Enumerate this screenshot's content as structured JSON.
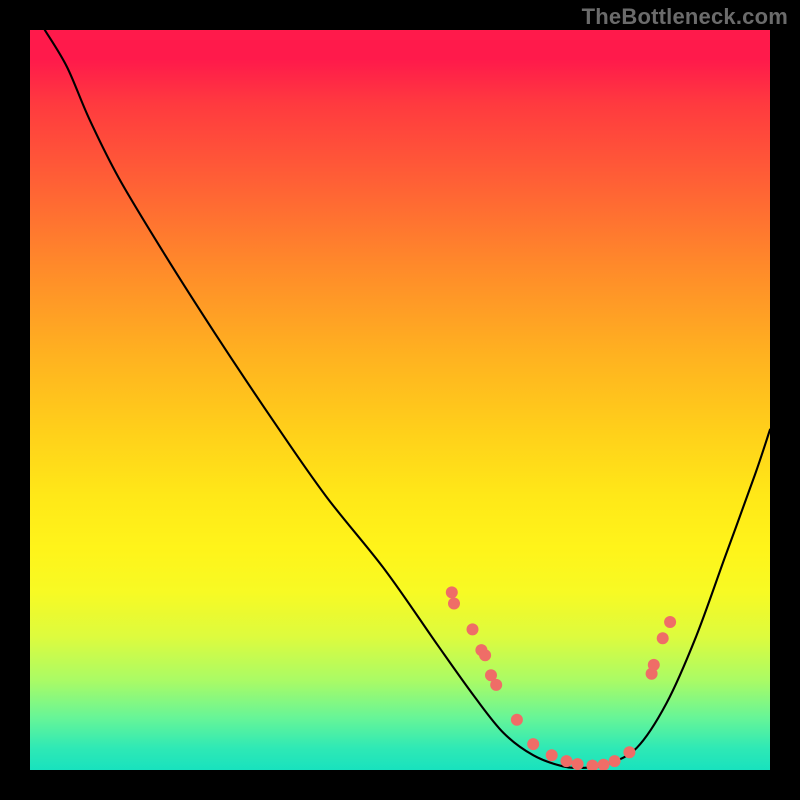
{
  "watermark": "TheBottleneck.com",
  "chart_data": {
    "type": "line",
    "title": "",
    "xlabel": "",
    "ylabel": "",
    "xlim": [
      0,
      100
    ],
    "ylim": [
      0,
      100
    ],
    "series": [
      {
        "name": "curve",
        "x": [
          2,
          5,
          8,
          12,
          18,
          25,
          33,
          40,
          48,
          55,
          60,
          64,
          68,
          72,
          75,
          78,
          82,
          86,
          90,
          94,
          98,
          100
        ],
        "values": [
          100,
          95,
          88,
          80,
          70,
          59,
          47,
          37,
          27,
          17,
          10,
          5,
          2,
          0.5,
          0.3,
          0.8,
          3,
          9,
          18,
          29,
          40,
          46
        ]
      }
    ],
    "scatter_points": {
      "name": "markers",
      "x": [
        57.0,
        57.3,
        59.8,
        61.0,
        61.5,
        62.3,
        63.0,
        65.8,
        68.0,
        70.5,
        72.5,
        74.0,
        76.0,
        77.5,
        79.0,
        81.0,
        84.0,
        84.3,
        85.5,
        86.5
      ],
      "values": [
        24.0,
        22.5,
        19.0,
        16.2,
        15.5,
        12.8,
        11.5,
        6.8,
        3.5,
        2.0,
        1.2,
        0.8,
        0.6,
        0.7,
        1.2,
        2.4,
        13.0,
        14.2,
        17.8,
        20.0
      ]
    },
    "gradient_stops": [
      {
        "pos": 0.0,
        "color": "#ff1a4b"
      },
      {
        "pos": 0.1,
        "color": "#ff3a3f"
      },
      {
        "pos": 0.32,
        "color": "#ff8a2a"
      },
      {
        "pos": 0.55,
        "color": "#ffd21a"
      },
      {
        "pos": 0.76,
        "color": "#f7fa24"
      },
      {
        "pos": 0.93,
        "color": "#66f598"
      },
      {
        "pos": 1.0,
        "color": "#18e2be"
      }
    ]
  }
}
